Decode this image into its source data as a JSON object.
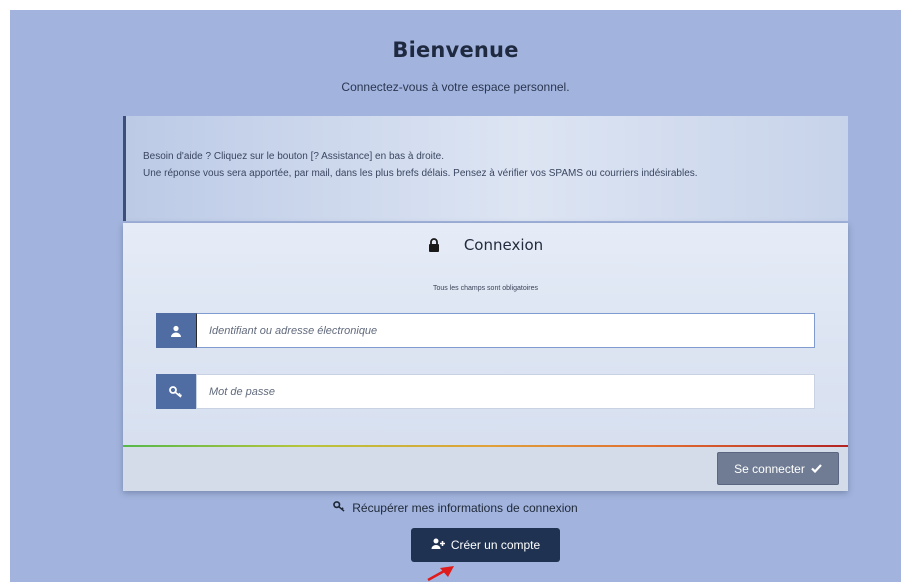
{
  "header": {
    "title": "Bienvenue",
    "subtitle": "Connectez-vous à votre espace personnel."
  },
  "help": {
    "line1": "Besoin d'aide ? Cliquez sur le bouton [? Assistance] en bas à droite.",
    "line2": "Une réponse vous sera apportée, par mail, dans les plus brefs délais. Pensez à vérifier vos SPAMS ou courriers indésirables."
  },
  "login": {
    "title": "Connexion",
    "title_icon": "lock-icon",
    "required_note": "Tous les champs sont obligatoires",
    "username": {
      "placeholder": "Identifiant ou adresse électronique",
      "value": "",
      "icon": "user-icon"
    },
    "password": {
      "placeholder": "Mot de passe",
      "value": "",
      "icon": "key-icon"
    },
    "submit_label": "Se connecter",
    "submit_icon": "check-icon"
  },
  "links": {
    "recover_label": "Récupérer mes informations de connexion",
    "recover_icon": "key-icon",
    "create_account_label": "Créer un compte",
    "create_account_icon": "add-user-icon"
  },
  "colors": {
    "background": "#a2b4dd",
    "addon_blue": "#4f6da3",
    "submit_button": "#6f7c93",
    "create_button": "#1f3252",
    "annotation_arrow": "#e01b1b"
  }
}
